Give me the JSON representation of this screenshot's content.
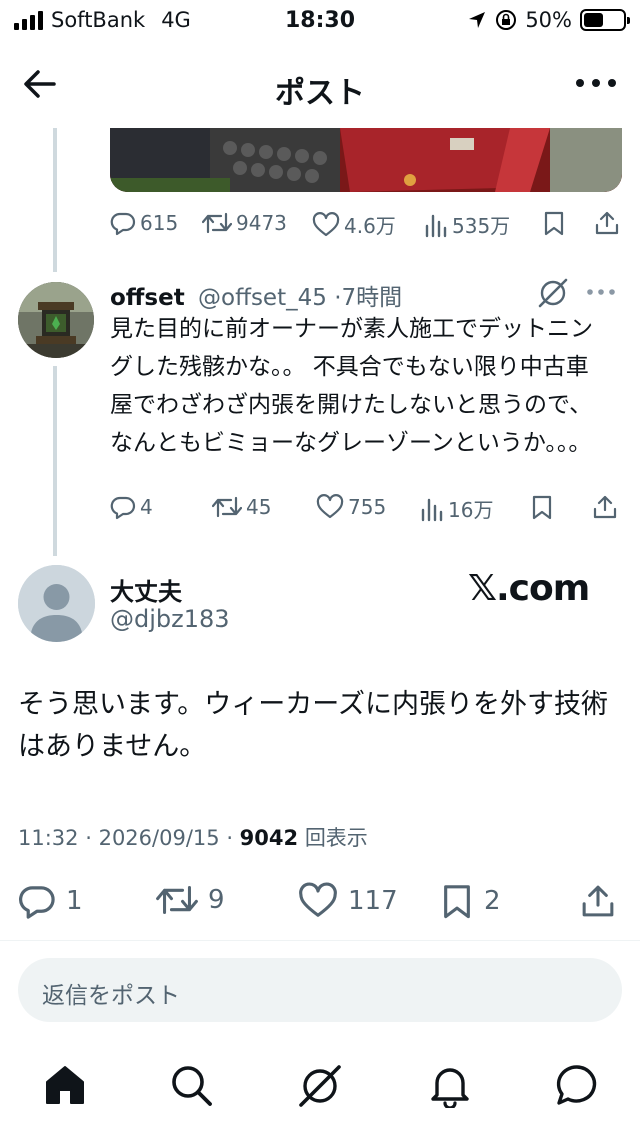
{
  "status_bar": {
    "carrier": "SoftBank",
    "network": "4G",
    "time": "18:30",
    "battery": "50%",
    "battery_level": 0.5
  },
  "header": {
    "title": "ポスト"
  },
  "parent_tweet_actions": {
    "replies": "615",
    "retweets": "9473",
    "likes": "4.6万",
    "views": "535万"
  },
  "reply_tweet": {
    "name": "offset",
    "handle": "@offset_45",
    "time": "·7時間",
    "text": "見た目的に前オーナーが素人施工でデットニングした残骸かな。。 不具合でもない限り中古車屋でわざわざ内張を開けたしないと思うので、なんともビミョーなグレーゾーンというか。。。",
    "replies": "4",
    "retweets": "45",
    "likes": "755",
    "views": "16万"
  },
  "main_tweet": {
    "name": "大丈夫",
    "handle": "@djbz183",
    "brand": "𝕏.com",
    "text": "そう思います。ウィーカーズに内張りを外す技術はありません。",
    "time": "11:32",
    "date": "2026/09/15",
    "view_count": "9042",
    "view_label": "回表示",
    "replies": "1",
    "retweets": "9",
    "likes": "117",
    "bookmarks": "2"
  },
  "reply_box": {
    "placeholder": "返信をポスト"
  },
  "colors": {
    "text": "#0f1419",
    "secondary": "#536471",
    "thread_line": "#cfd9de",
    "divider": "#eff3f4"
  }
}
